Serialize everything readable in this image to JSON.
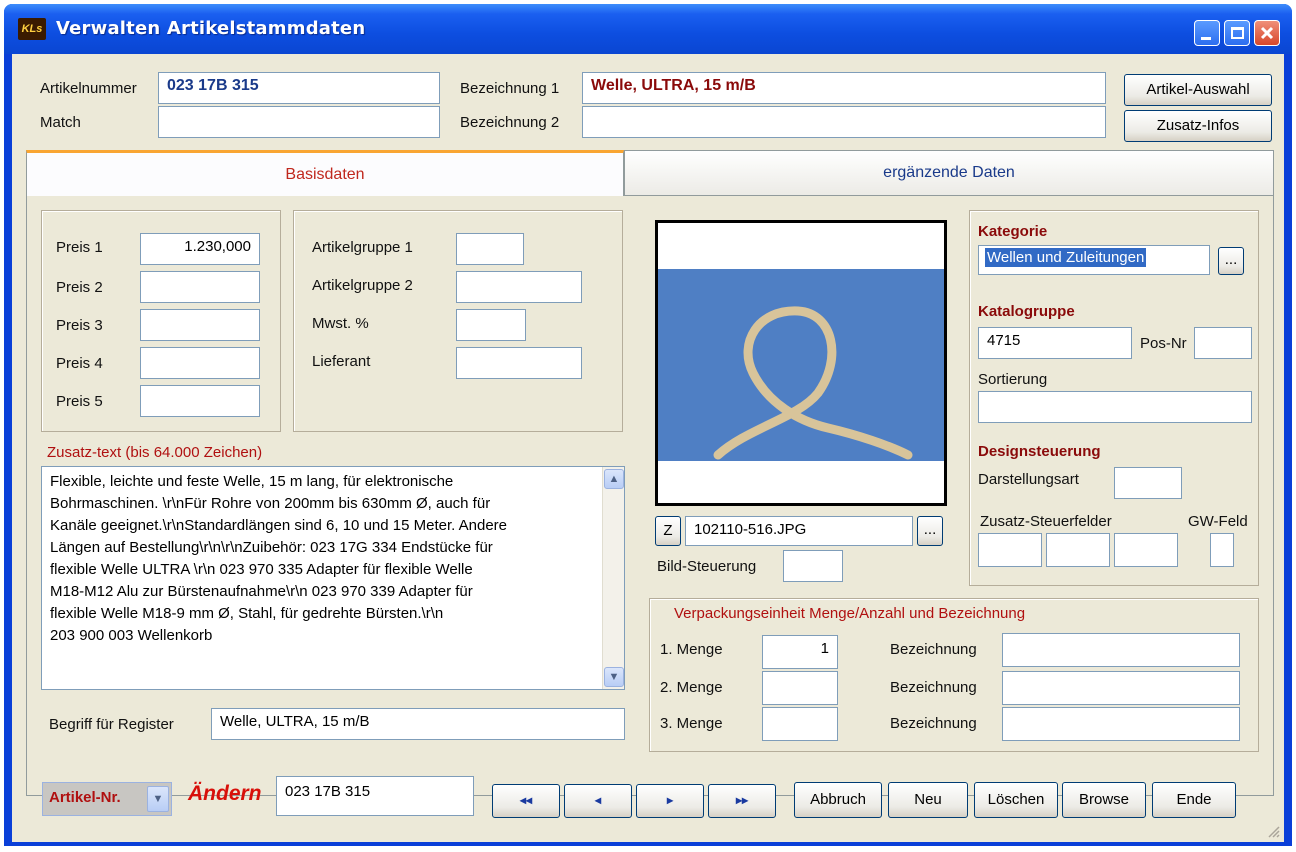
{
  "window": {
    "title": "Verwalten Artikelstammdaten",
    "logo_text": "KLs"
  },
  "header": {
    "artikelnummer_label": "Artikelnummer",
    "artikelnummer_value": "023 17B 315",
    "match_label": "Match",
    "match_value": "",
    "bez1_label": "Bezeichnung 1",
    "bez1_value": "Welle, ULTRA, 15 m/B",
    "bez2_label": "Bezeichnung 2",
    "bez2_value": "",
    "artikel_auswahl": "Artikel-Auswahl",
    "zusatz_infos": "Zusatz-Infos"
  },
  "tabs": [
    {
      "label": "Basisdaten",
      "active": true
    },
    {
      "label": "ergänzende Daten",
      "active": false
    }
  ],
  "preise": [
    {
      "label": "Preis 1",
      "value": "1.230,000"
    },
    {
      "label": "Preis 2",
      "value": ""
    },
    {
      "label": "Preis 3",
      "value": ""
    },
    {
      "label": "Preis 4",
      "value": ""
    },
    {
      "label": "Preis 5",
      "value": ""
    }
  ],
  "gruppen": [
    {
      "label": "Artikelgruppe 1",
      "value": ""
    },
    {
      "label": "Artikelgruppe 2",
      "value": ""
    },
    {
      "label": "Mwst. %",
      "value": ""
    },
    {
      "label": "Lieferant",
      "value": ""
    }
  ],
  "zusatztext": {
    "label": "Zusatz-text (bis 64.000 Zeichen)",
    "lines": [
      "Flexible, leichte und feste Welle, 15 m lang, für elektronische",
      "Bohrmaschinen. \\r\\nFür Rohre von 200mm bis   630mm Ø, auch für",
      "Kanäle geeignet.\\r\\nStandardlängen sind 6, 10 und 15 Meter. Andere",
      "Längen auf Bestellung\\r\\n\\r\\nZuibehör: 023 17G 334 Endstücke für",
      "flexible  Welle ULTRA \\r\\n  023 970 335 Adapter für flexible Welle",
      "M18-M12 Alu zur Bürstenaufnahme\\r\\n  023 970 339 Adapter für",
      "flexible Welle M18-9 mm Ø, Stahl, für gedrehte Bürsten.\\r\\n",
      "203 900 003 Wellenkorb"
    ]
  },
  "register": {
    "label": "Begriff für Register",
    "value": "Welle, ULTRA, 15 m/B"
  },
  "bild": {
    "z_button": "Z",
    "filename": "102110-516.JPG",
    "browse": "...",
    "steuerung_label": "Bild-Steuerung",
    "steuerung_value": "",
    "bg_color": "#4f7fc4",
    "rope_color": "#d8c49a"
  },
  "kategorie": {
    "title": "Kategorie",
    "value": "Wellen und Zuleitungen",
    "browse": "...",
    "katalog_title": "Katalogruppe",
    "katalog_value": "4715",
    "posnr_label": "Pos-Nr",
    "posnr_value": "",
    "sortierung_label": "Sortierung",
    "sortierung_value": "",
    "design_title": "Designsteuerung",
    "darstellung_label": "Darstellungsart",
    "darstellung_value": "",
    "zusatz_steuer_label": "Zusatz-Steuerfelder",
    "gw_label": "GW-Feld"
  },
  "verpackung": {
    "title": "Verpackungseinheit  Menge/Anzahl  und  Bezeichnung",
    "rows": [
      {
        "label": "1. Menge",
        "value": "1",
        "bez_label": "Bezeichnung",
        "bez_value": ""
      },
      {
        "label": "2. Menge",
        "value": "",
        "bez_label": "Bezeichnung",
        "bez_value": ""
      },
      {
        "label": "3. Menge",
        "value": "",
        "bez_label": "Bezeichnung",
        "bez_value": ""
      }
    ]
  },
  "footer": {
    "select_value": "Artikel-Nr.",
    "mode": "Ändern",
    "search_value": "023 17B 315",
    "nav_first": "◂◂",
    "nav_prev": "◂",
    "nav_next": "▸",
    "nav_last": "▸▸",
    "abbruch": "Abbruch",
    "neu": "Neu",
    "loeschen": "Löschen",
    "browse": "Browse",
    "ende": "Ende"
  },
  "colors": {
    "title_blue": "#0a46d2",
    "accent_red": "#b01010",
    "tab_highlight": "#f9a532"
  }
}
